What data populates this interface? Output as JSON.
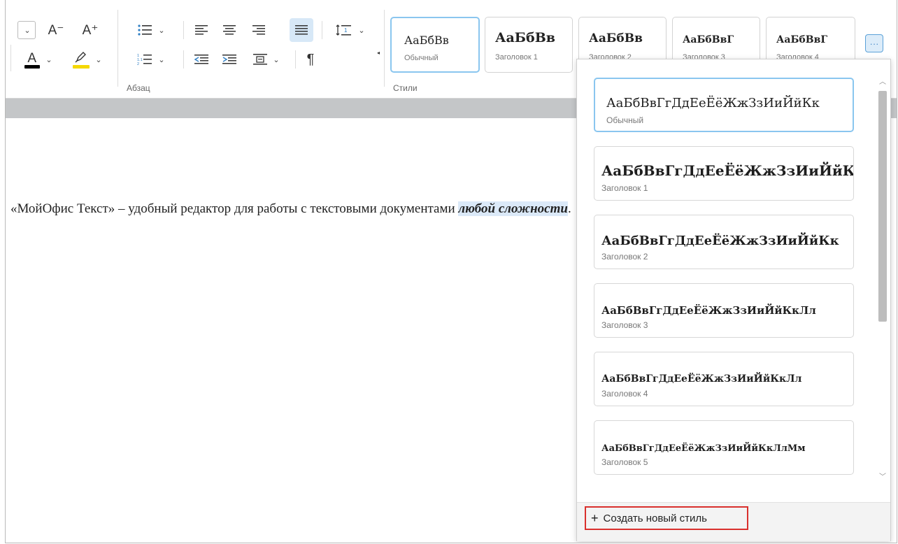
{
  "toolbar": {
    "font": {
      "decrease_label": "A⁻",
      "increase_label": "A⁺",
      "font_color": "#000000",
      "highlight_color": "#f5d800"
    },
    "paragraph": {
      "section_label": "Абзац",
      "pilcrow": "¶"
    },
    "styles": {
      "section_label": "Стили",
      "cards": [
        {
          "sample": "АаБбВв",
          "name": "Обычный"
        },
        {
          "sample": "АаБбВв",
          "name": "Заголовок 1"
        },
        {
          "sample": "АаБбВв",
          "name": "Заголовок 2"
        },
        {
          "sample": "АаБбВвГ",
          "name": "Заголовок 3"
        },
        {
          "sample": "АаБбВвГ",
          "name": "Заголовок 4"
        }
      ],
      "more_label": "···"
    }
  },
  "document": {
    "text_main": "«МойОфис Текст» – удобный редактор для работы с текстовыми документами ",
    "text_highlight": "любой сложности",
    "text_end": "."
  },
  "styles_dropdown": {
    "items": [
      {
        "sample": "АаБбВвГгДдЕеЁёЖжЗзИиЙйКк",
        "name": "Обычный"
      },
      {
        "sample": "АаБбВвГгДдЕеЁёЖжЗзИиЙйКк",
        "name": "Заголовок 1"
      },
      {
        "sample": "АаБбВвГгДдЕеЁёЖжЗзИиЙйКк",
        "name": "Заголовок 2"
      },
      {
        "sample": "АаБбВвГгДдЕеЁёЖжЗзИиЙйКкЛл",
        "name": "Заголовок 3"
      },
      {
        "sample": "АаБбВвГгДдЕеЁёЖжЗзИиЙйКкЛл",
        "name": "Заголовок 4"
      },
      {
        "sample": "АаБбВвГгДдЕеЁёЖжЗзИиЙйКкЛлМм",
        "name": "Заголовок 5"
      }
    ],
    "create_plus": "+",
    "create_label": "Создать новый стиль"
  }
}
